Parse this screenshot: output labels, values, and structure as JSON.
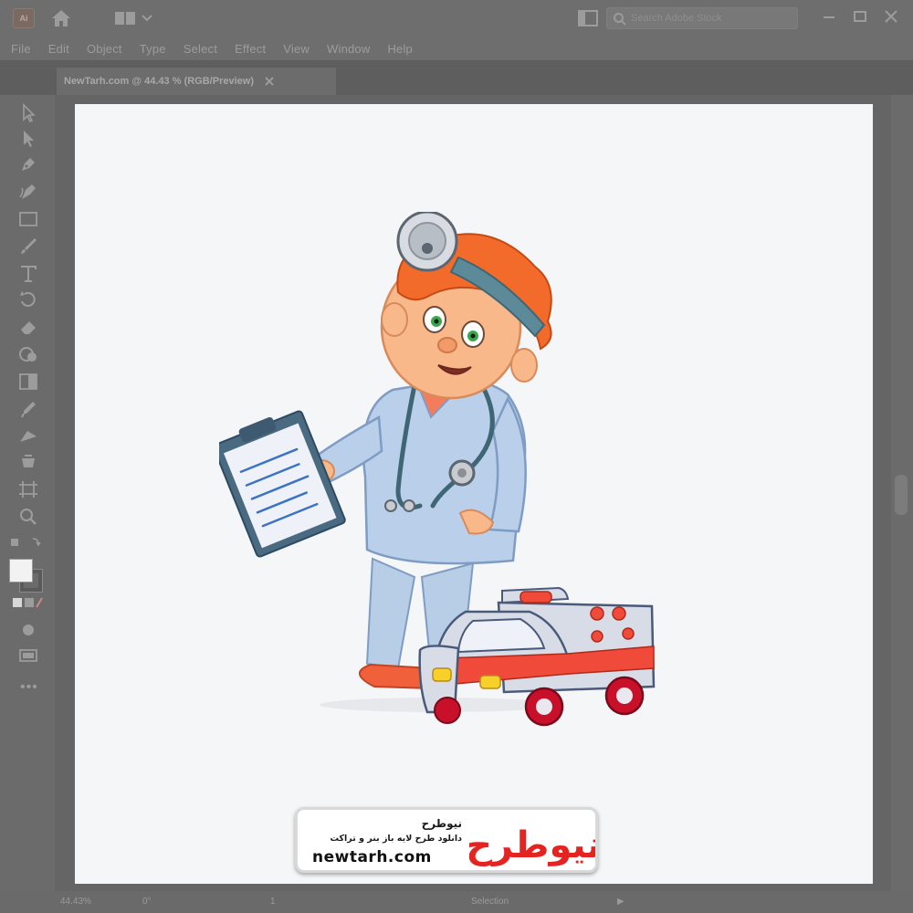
{
  "app": {
    "logo_text": "Ai",
    "search_placeholder": "Search Adobe Stock"
  },
  "menu": [
    "File",
    "Edit",
    "Object",
    "Type",
    "Select",
    "Effect",
    "View",
    "Window",
    "Help"
  ],
  "document": {
    "tab_title": "NewTarh.com @ 44.43 % (RGB/Preview)"
  },
  "status": {
    "zoom": "44.43%",
    "rotation": "0°",
    "artboard": "1",
    "mode": "Selection"
  },
  "watermark": {
    "title": "نیوطرح",
    "subtitle": "دانلود طرح لایه باز بنر و تراکت",
    "url": "newtarh.com",
    "logo_text": "نیوطرح",
    "logo_color": "#e52421"
  },
  "colors": {
    "chrome": "#6e6e6e",
    "artboard": "#f5f6f8"
  }
}
